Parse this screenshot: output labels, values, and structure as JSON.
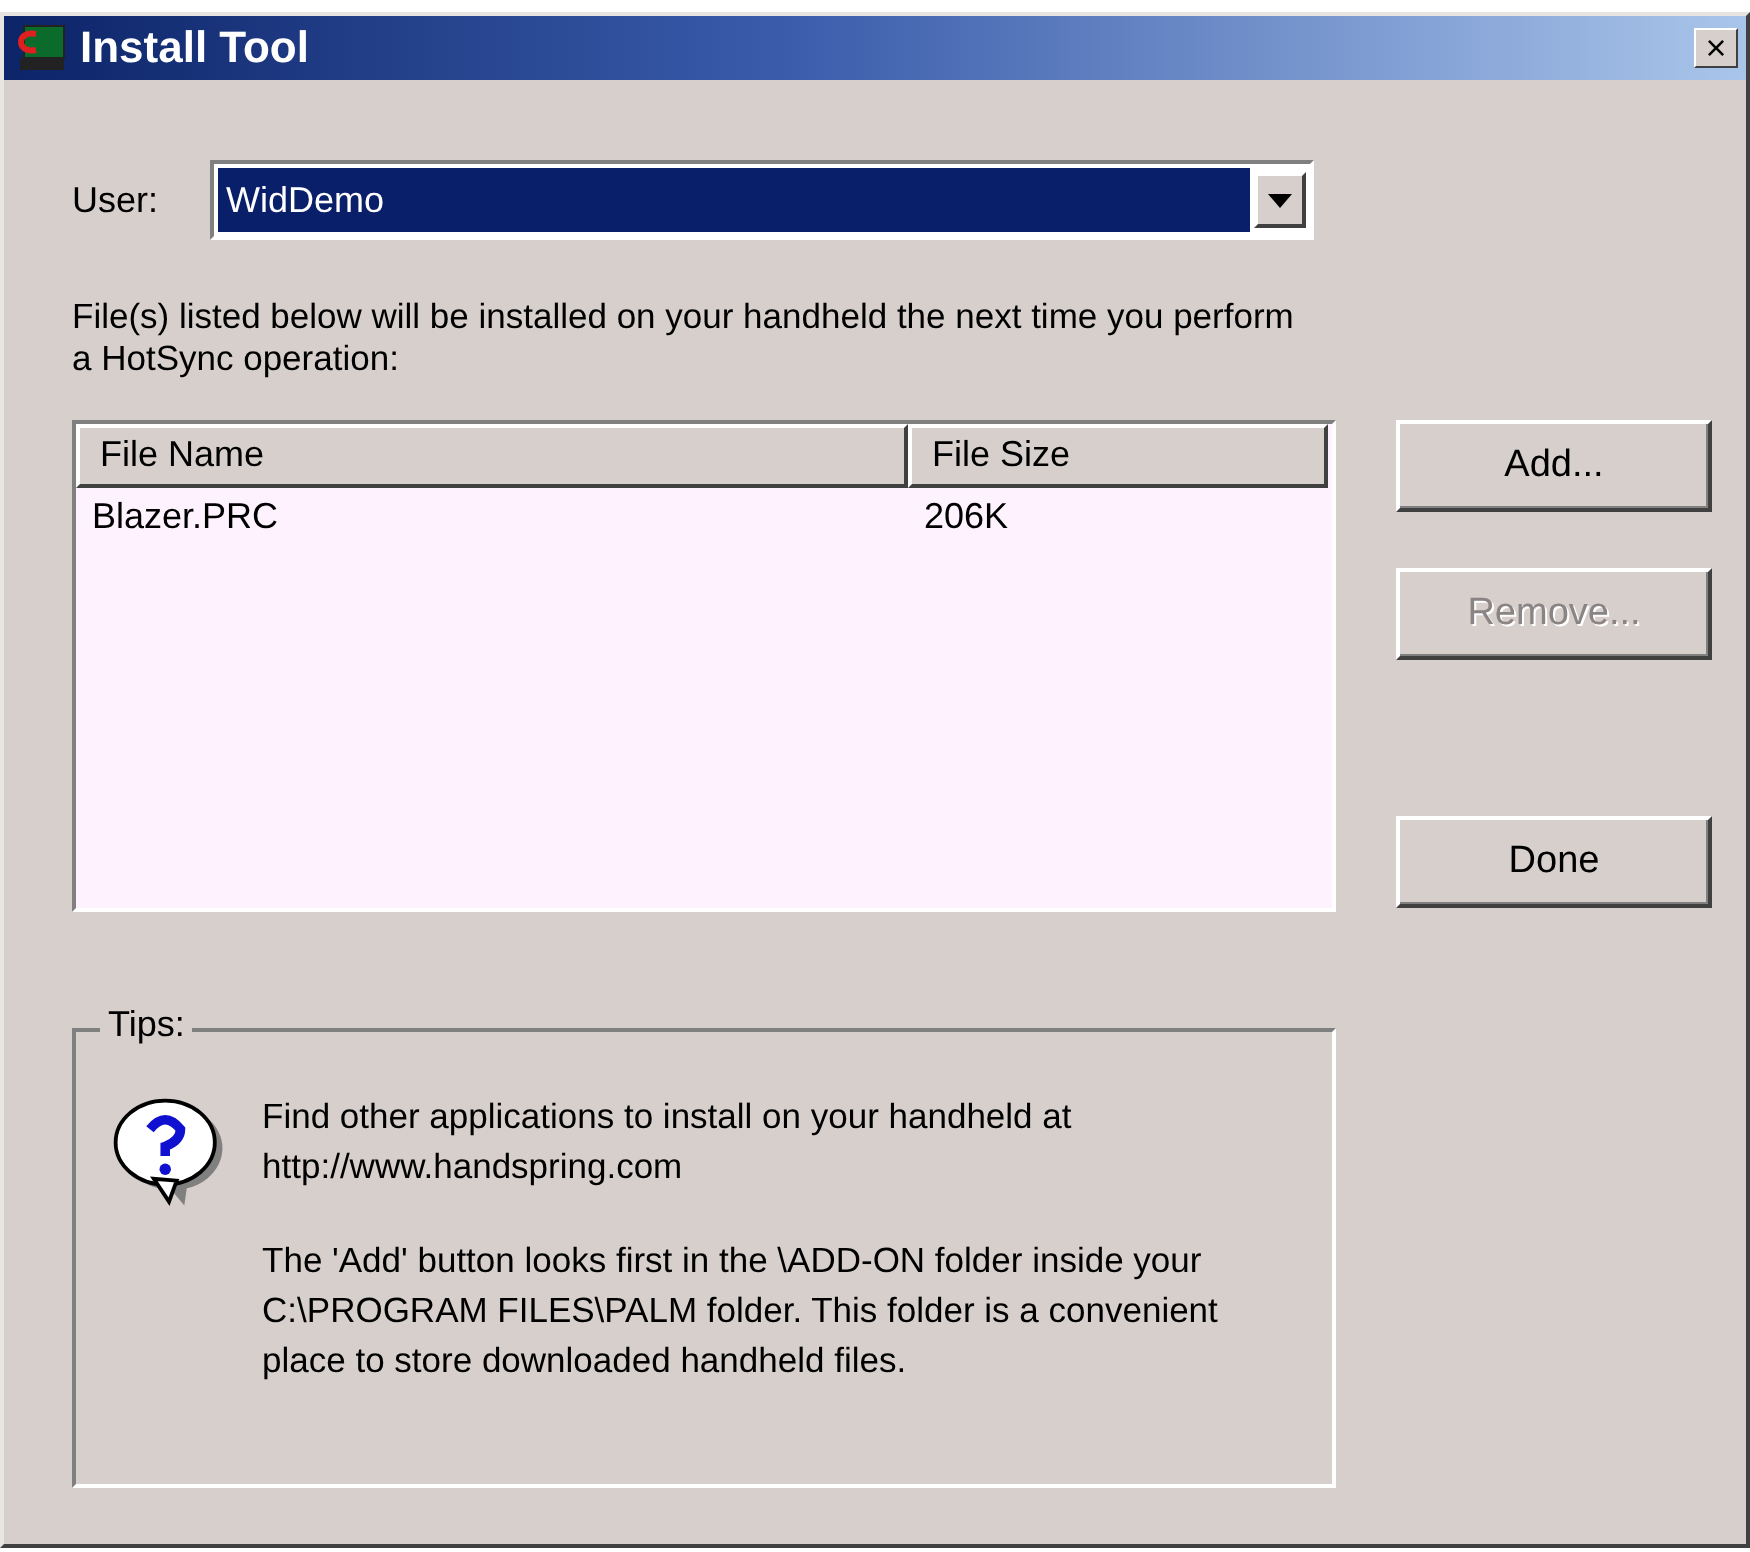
{
  "window": {
    "title": "Install Tool",
    "close": "×"
  },
  "user": {
    "label": "User:",
    "value": "WidDemo",
    "highlighted": true
  },
  "instructions": "File(s) listed below will be installed on your handheld the next time you perform a HotSync operation:",
  "table": {
    "columns": [
      "File Name",
      "File Size"
    ],
    "rows": [
      {
        "cells": [
          "Blazer.PRC",
          "206K"
        ],
        "selected": false
      }
    ]
  },
  "buttons": [
    {
      "label": "Add...",
      "disabled": false
    },
    {
      "label": "Remove...",
      "disabled": true
    },
    {
      "label": "Done",
      "disabled": false
    }
  ],
  "tips": {
    "title": "Tips:",
    "paragraphs": [
      "Find other applications to install on your handheld at http://www.handspring.com",
      "The 'Add' button looks first in the \\ADD-ON folder inside your C:\\PROGRAM FILES\\PALM folder. This folder is a convenient place to store downloaded handheld files."
    ]
  }
}
